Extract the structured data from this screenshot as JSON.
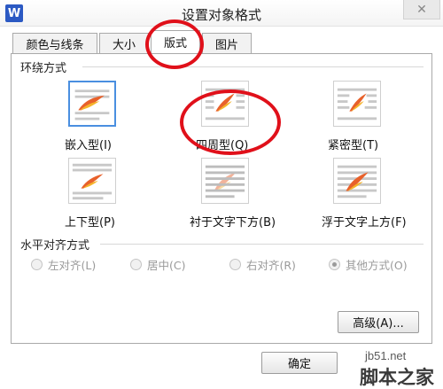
{
  "window": {
    "app_icon_label": "W",
    "title": "设置对象格式",
    "close_glyph": "✕"
  },
  "tabs": [
    {
      "label": "颜色与线条"
    },
    {
      "label": "大小"
    },
    {
      "label": "版式",
      "active": true
    },
    {
      "label": "图片"
    }
  ],
  "wrap_section": {
    "title": "环绕方式",
    "options": [
      {
        "label": "嵌入型(I)",
        "selected": true,
        "icon": "inline-wrap-icon"
      },
      {
        "label": "四周型(Q)",
        "selected": false,
        "icon": "square-wrap-icon"
      },
      {
        "label": "紧密型(T)",
        "selected": false,
        "icon": "tight-wrap-icon"
      },
      {
        "label": "上下型(P)",
        "selected": false,
        "icon": "top-bottom-wrap-icon"
      },
      {
        "label": "衬于文字下方(B)",
        "selected": false,
        "icon": "behind-text-icon"
      },
      {
        "label": "浮于文字上方(F)",
        "selected": false,
        "icon": "in-front-of-text-icon"
      }
    ]
  },
  "align_section": {
    "title": "水平对齐方式",
    "options": [
      {
        "label": "左对齐(L)",
        "checked": false
      },
      {
        "label": "居中(C)",
        "checked": false
      },
      {
        "label": "右对齐(R)",
        "checked": false
      },
      {
        "label": "其他方式(O)",
        "checked": true
      }
    ]
  },
  "buttons": {
    "advanced": "高级(A)...",
    "ok": "确定"
  },
  "watermark": {
    "url": "jb51.net",
    "text": "脚本之家"
  },
  "colors": {
    "annotation": "#e0101a",
    "selection": "#4a8fe0"
  }
}
